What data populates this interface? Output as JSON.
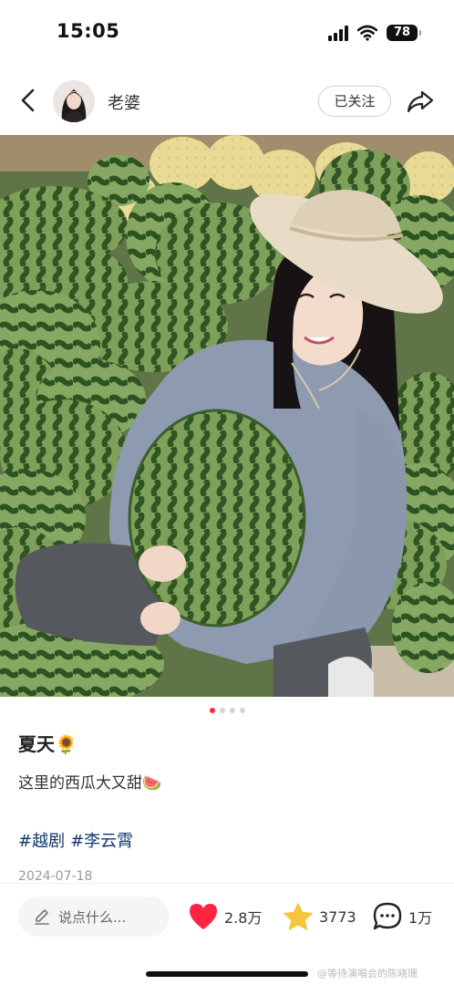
{
  "status_bar": {
    "time": "15:05",
    "battery": "78"
  },
  "header": {
    "author_name": "老婆",
    "follow_label": "已关注"
  },
  "post": {
    "image_count": 4,
    "active_image": 1,
    "title": "夏天🌻",
    "body": "这里的西瓜大又甜🍉",
    "tags": [
      "#越剧",
      "#李云霄"
    ],
    "date": "2024-07-18"
  },
  "actions": {
    "comment_placeholder": "说点什么...",
    "likes": "2.8万",
    "favorites": "3773",
    "comments": "1万"
  },
  "watermark": "@等待演唱会的陈晓珊",
  "colors": {
    "accent": "#ff2442",
    "star": "#f5c53d",
    "tag": "#13386c"
  }
}
